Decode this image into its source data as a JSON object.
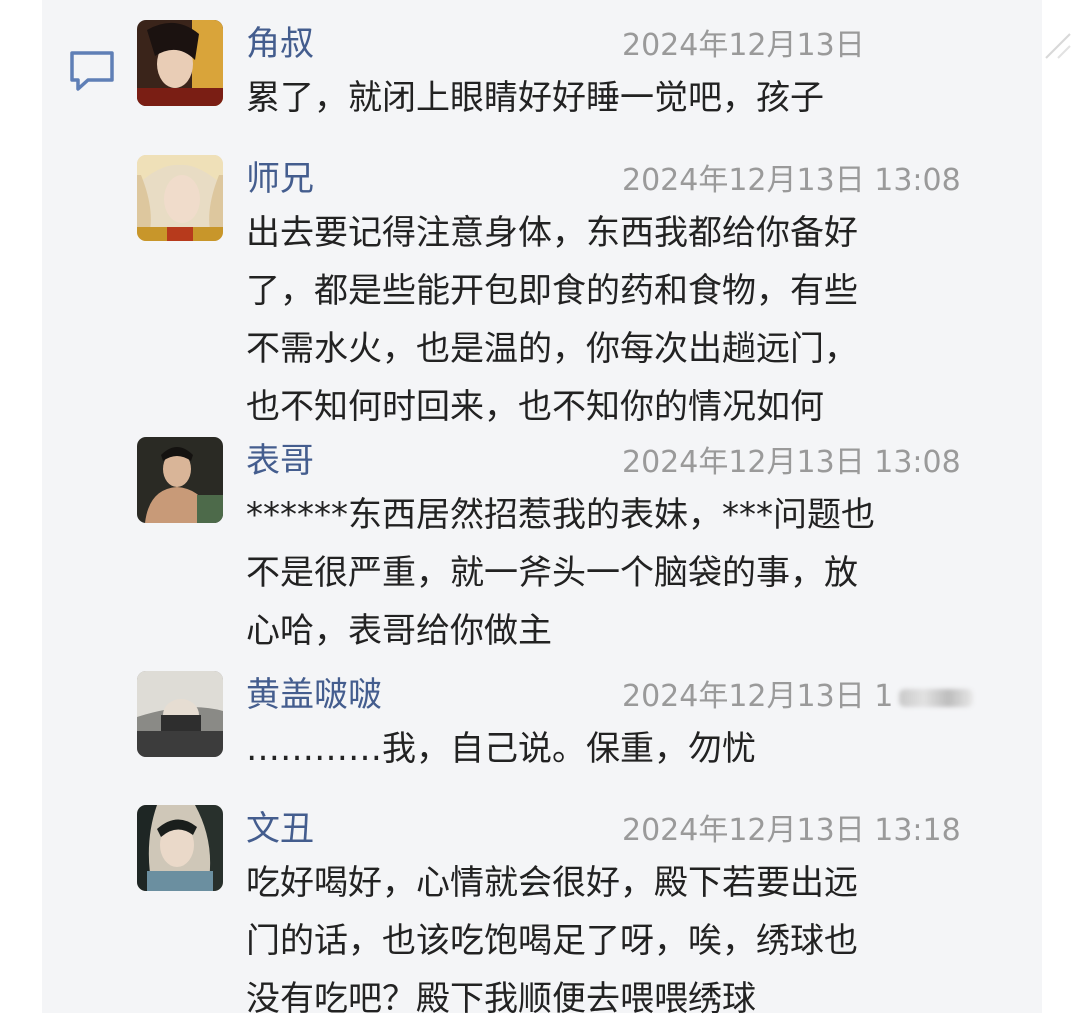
{
  "comments": [
    {
      "name": "角叔",
      "time": "2024年12月13日",
      "text": "累了，就闭上眼睛好好睡一觉吧，孩子"
    },
    {
      "name": "师兄",
      "time": "2024年12月13日 13:08",
      "text": "出去要记得注意身体，东西我都给你备好\n了，都是些能开包即食的药和食物，有些\n不需水火，也是温的，你每次出趟远门，\n也不知何时回来，也不知你的情况如何"
    },
    {
      "name": "表哥",
      "time": "2024年12月13日 13:08",
      "text": "******东西居然招惹我的表妹，***问题也\n不是很严重，就一斧头一个脑袋的事，放\n心哈，表哥给你做主"
    },
    {
      "name": "黄盖啵啵",
      "time": "2024年12月13日 1",
      "text": "…………我，自己说。保重，勿忧"
    },
    {
      "name": "文丑",
      "time": "2024年12月13日 13:18",
      "text": "吃好喝好，心情就会很好，殿下若要出远\n门的话，也该吃饱喝足了呀，唉，绣球也\n没有吃吧？殿下我顺便去喂喂绣球"
    }
  ],
  "icons": {
    "side": "comment-bubble-icon",
    "avatars": [
      "avatar-1",
      "avatar-2",
      "avatar-3",
      "avatar-4",
      "avatar-5"
    ]
  },
  "colors": {
    "name": "#445d8e",
    "time": "#9a9a9a",
    "text": "#222222",
    "panel": "#f4f5f7"
  }
}
